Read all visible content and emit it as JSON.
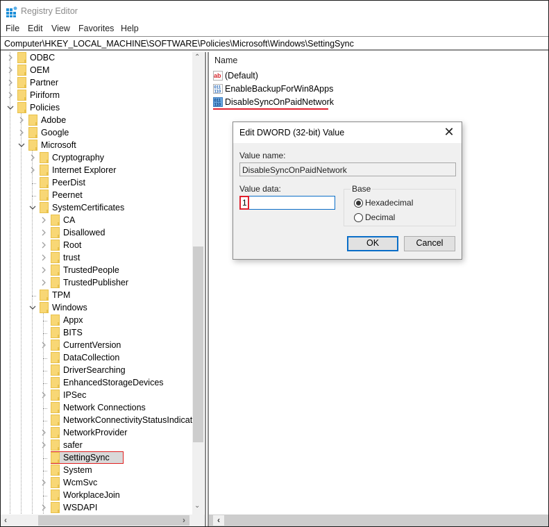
{
  "window": {
    "title": "Registry Editor",
    "icon": "registry-editor-icon"
  },
  "menu": [
    "File",
    "Edit",
    "View",
    "Favorites",
    "Help"
  ],
  "address": "Computer\\HKEY_LOCAL_MACHINE\\SOFTWARE\\Policies\\Microsoft\\Windows\\SettingSync",
  "tree": {
    "items": [
      {
        "label": "ODBC",
        "level": 0,
        "state": "collapsed"
      },
      {
        "label": "OEM",
        "level": 0,
        "state": "collapsed"
      },
      {
        "label": "Partner",
        "level": 0,
        "state": "collapsed"
      },
      {
        "label": "Piriform",
        "level": 0,
        "state": "collapsed"
      },
      {
        "label": "Policies",
        "level": 0,
        "state": "expanded"
      },
      {
        "label": "Adobe",
        "level": 1,
        "state": "collapsed"
      },
      {
        "label": "Google",
        "level": 1,
        "state": "collapsed"
      },
      {
        "label": "Microsoft",
        "level": 1,
        "state": "expanded"
      },
      {
        "label": "Cryptography",
        "level": 2,
        "state": "collapsed"
      },
      {
        "label": "Internet Explorer",
        "level": 2,
        "state": "collapsed"
      },
      {
        "label": "PeerDist",
        "level": 2,
        "state": "leaf"
      },
      {
        "label": "Peernet",
        "level": 2,
        "state": "leaf"
      },
      {
        "label": "SystemCertificates",
        "level": 2,
        "state": "expanded"
      },
      {
        "label": "CA",
        "level": 3,
        "state": "collapsed"
      },
      {
        "label": "Disallowed",
        "level": 3,
        "state": "collapsed"
      },
      {
        "label": "Root",
        "level": 3,
        "state": "collapsed"
      },
      {
        "label": "trust",
        "level": 3,
        "state": "collapsed"
      },
      {
        "label": "TrustedPeople",
        "level": 3,
        "state": "collapsed"
      },
      {
        "label": "TrustedPublisher",
        "level": 3,
        "state": "collapsed"
      },
      {
        "label": "TPM",
        "level": 2,
        "state": "leaf"
      },
      {
        "label": "Windows",
        "level": 2,
        "state": "expanded"
      },
      {
        "label": "Appx",
        "level": 3,
        "state": "leaf"
      },
      {
        "label": "BITS",
        "level": 3,
        "state": "leaf"
      },
      {
        "label": "CurrentVersion",
        "level": 3,
        "state": "collapsed"
      },
      {
        "label": "DataCollection",
        "level": 3,
        "state": "leaf"
      },
      {
        "label": "DriverSearching",
        "level": 3,
        "state": "leaf"
      },
      {
        "label": "EnhancedStorageDevices",
        "level": 3,
        "state": "leaf"
      },
      {
        "label": "IPSec",
        "level": 3,
        "state": "collapsed"
      },
      {
        "label": "Network Connections",
        "level": 3,
        "state": "leaf"
      },
      {
        "label": "NetworkConnectivityStatusIndicator",
        "level": 3,
        "state": "leaf"
      },
      {
        "label": "NetworkProvider",
        "level": 3,
        "state": "collapsed"
      },
      {
        "label": "safer",
        "level": 3,
        "state": "collapsed"
      },
      {
        "label": "SettingSync",
        "level": 3,
        "state": "leaf",
        "selected": true
      },
      {
        "label": "System",
        "level": 3,
        "state": "leaf"
      },
      {
        "label": "WcmSvc",
        "level": 3,
        "state": "collapsed"
      },
      {
        "label": "WorkplaceJoin",
        "level": 3,
        "state": "leaf"
      },
      {
        "label": "WSDAPI",
        "level": 3,
        "state": "collapsed"
      }
    ]
  },
  "values": {
    "column_header": "Name",
    "rows": [
      {
        "name": "(Default)",
        "type": "string",
        "icon": "reg-sz-icon"
      },
      {
        "name": "EnableBackupForWin8Apps",
        "type": "binary",
        "icon": "reg-dword-icon"
      },
      {
        "name": "DisableSyncOnPaidNetwork",
        "type": "binary",
        "icon": "reg-dword-icon",
        "highlighted": true
      }
    ]
  },
  "dialog": {
    "title": "Edit DWORD (32-bit) Value",
    "value_name_label": "Value name:",
    "value_name": "DisableSyncOnPaidNetwork",
    "value_data_label": "Value data:",
    "value_data": "1",
    "base_label": "Base",
    "base_options": [
      {
        "label": "Hexadecimal",
        "checked": true
      },
      {
        "label": "Decimal",
        "checked": false
      }
    ],
    "ok_label": "OK",
    "cancel_label": "Cancel"
  },
  "colors": {
    "accent": "#0a6ec8",
    "highlight": "#e0202e",
    "folder": "#f8d775"
  }
}
